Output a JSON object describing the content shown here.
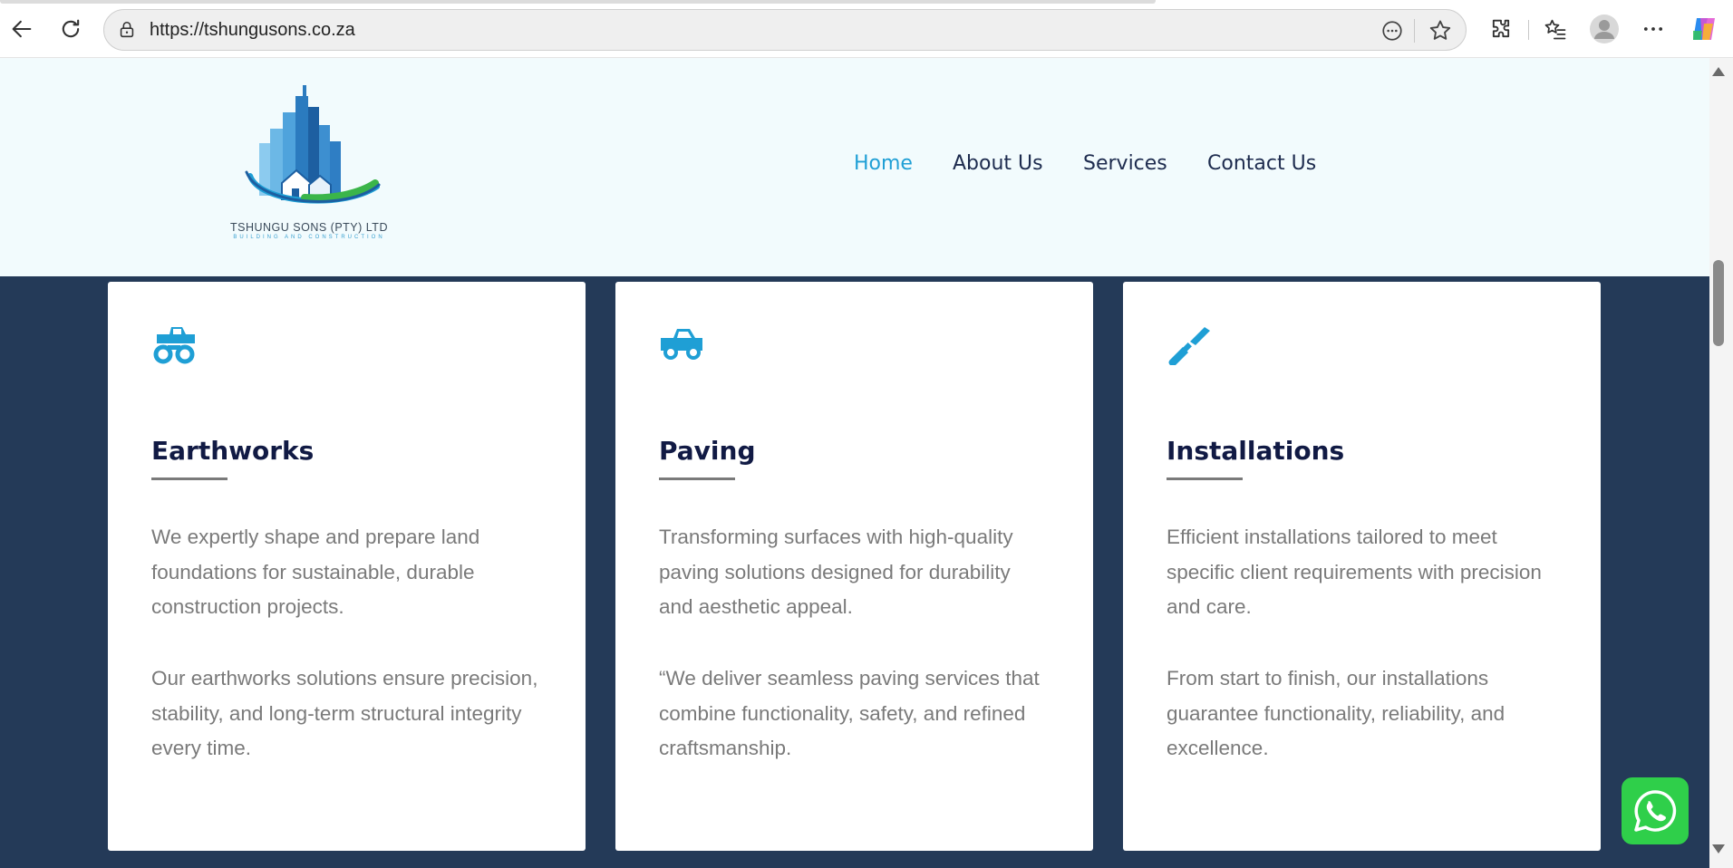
{
  "browser": {
    "url": "https://tshungusons.co.za"
  },
  "site": {
    "logo": {
      "name": "TSHUNGU SONS (PTY) LTD",
      "tagline": "BUILDING AND CONSTRUCTION"
    },
    "nav": {
      "items": [
        {
          "label": "Home",
          "active": true
        },
        {
          "label": "About Us",
          "active": false
        },
        {
          "label": "Services",
          "active": false
        },
        {
          "label": "Contact Us",
          "active": false
        }
      ]
    },
    "services": [
      {
        "icon": "monster-truck-icon",
        "title": "Earthworks",
        "p1": "We expertly shape and prepare land foundations for sustainable, durable construction projects.",
        "p2": "Our earthworks solutions ensure precision, stability, and long-term structural integrity every time."
      },
      {
        "icon": "truck-pickup-icon",
        "title": "Paving",
        "p1": "Transforming surfaces with high-quality paving solutions designed for durability and aesthetic appeal.",
        "p2": "“We deliver seamless paving services that combine functionality, safety, and refined craftsmanship."
      },
      {
        "icon": "screwdriver-icon",
        "title": "Installations",
        "p1": "Efficient installations tailored to meet specific client requirements with precision and care.",
        "p2": "From start to finish, our installations guarantee functionality, reliability, and excellence."
      }
    ]
  },
  "colors": {
    "accent": "#1f9fd5",
    "nav_text": "#1d2b4e",
    "header_bg": "#f2fbfd",
    "section_bg": "#243a58",
    "title_text": "#111a44",
    "body_text": "#7a7a7a",
    "whatsapp": "#2fcf4a"
  }
}
